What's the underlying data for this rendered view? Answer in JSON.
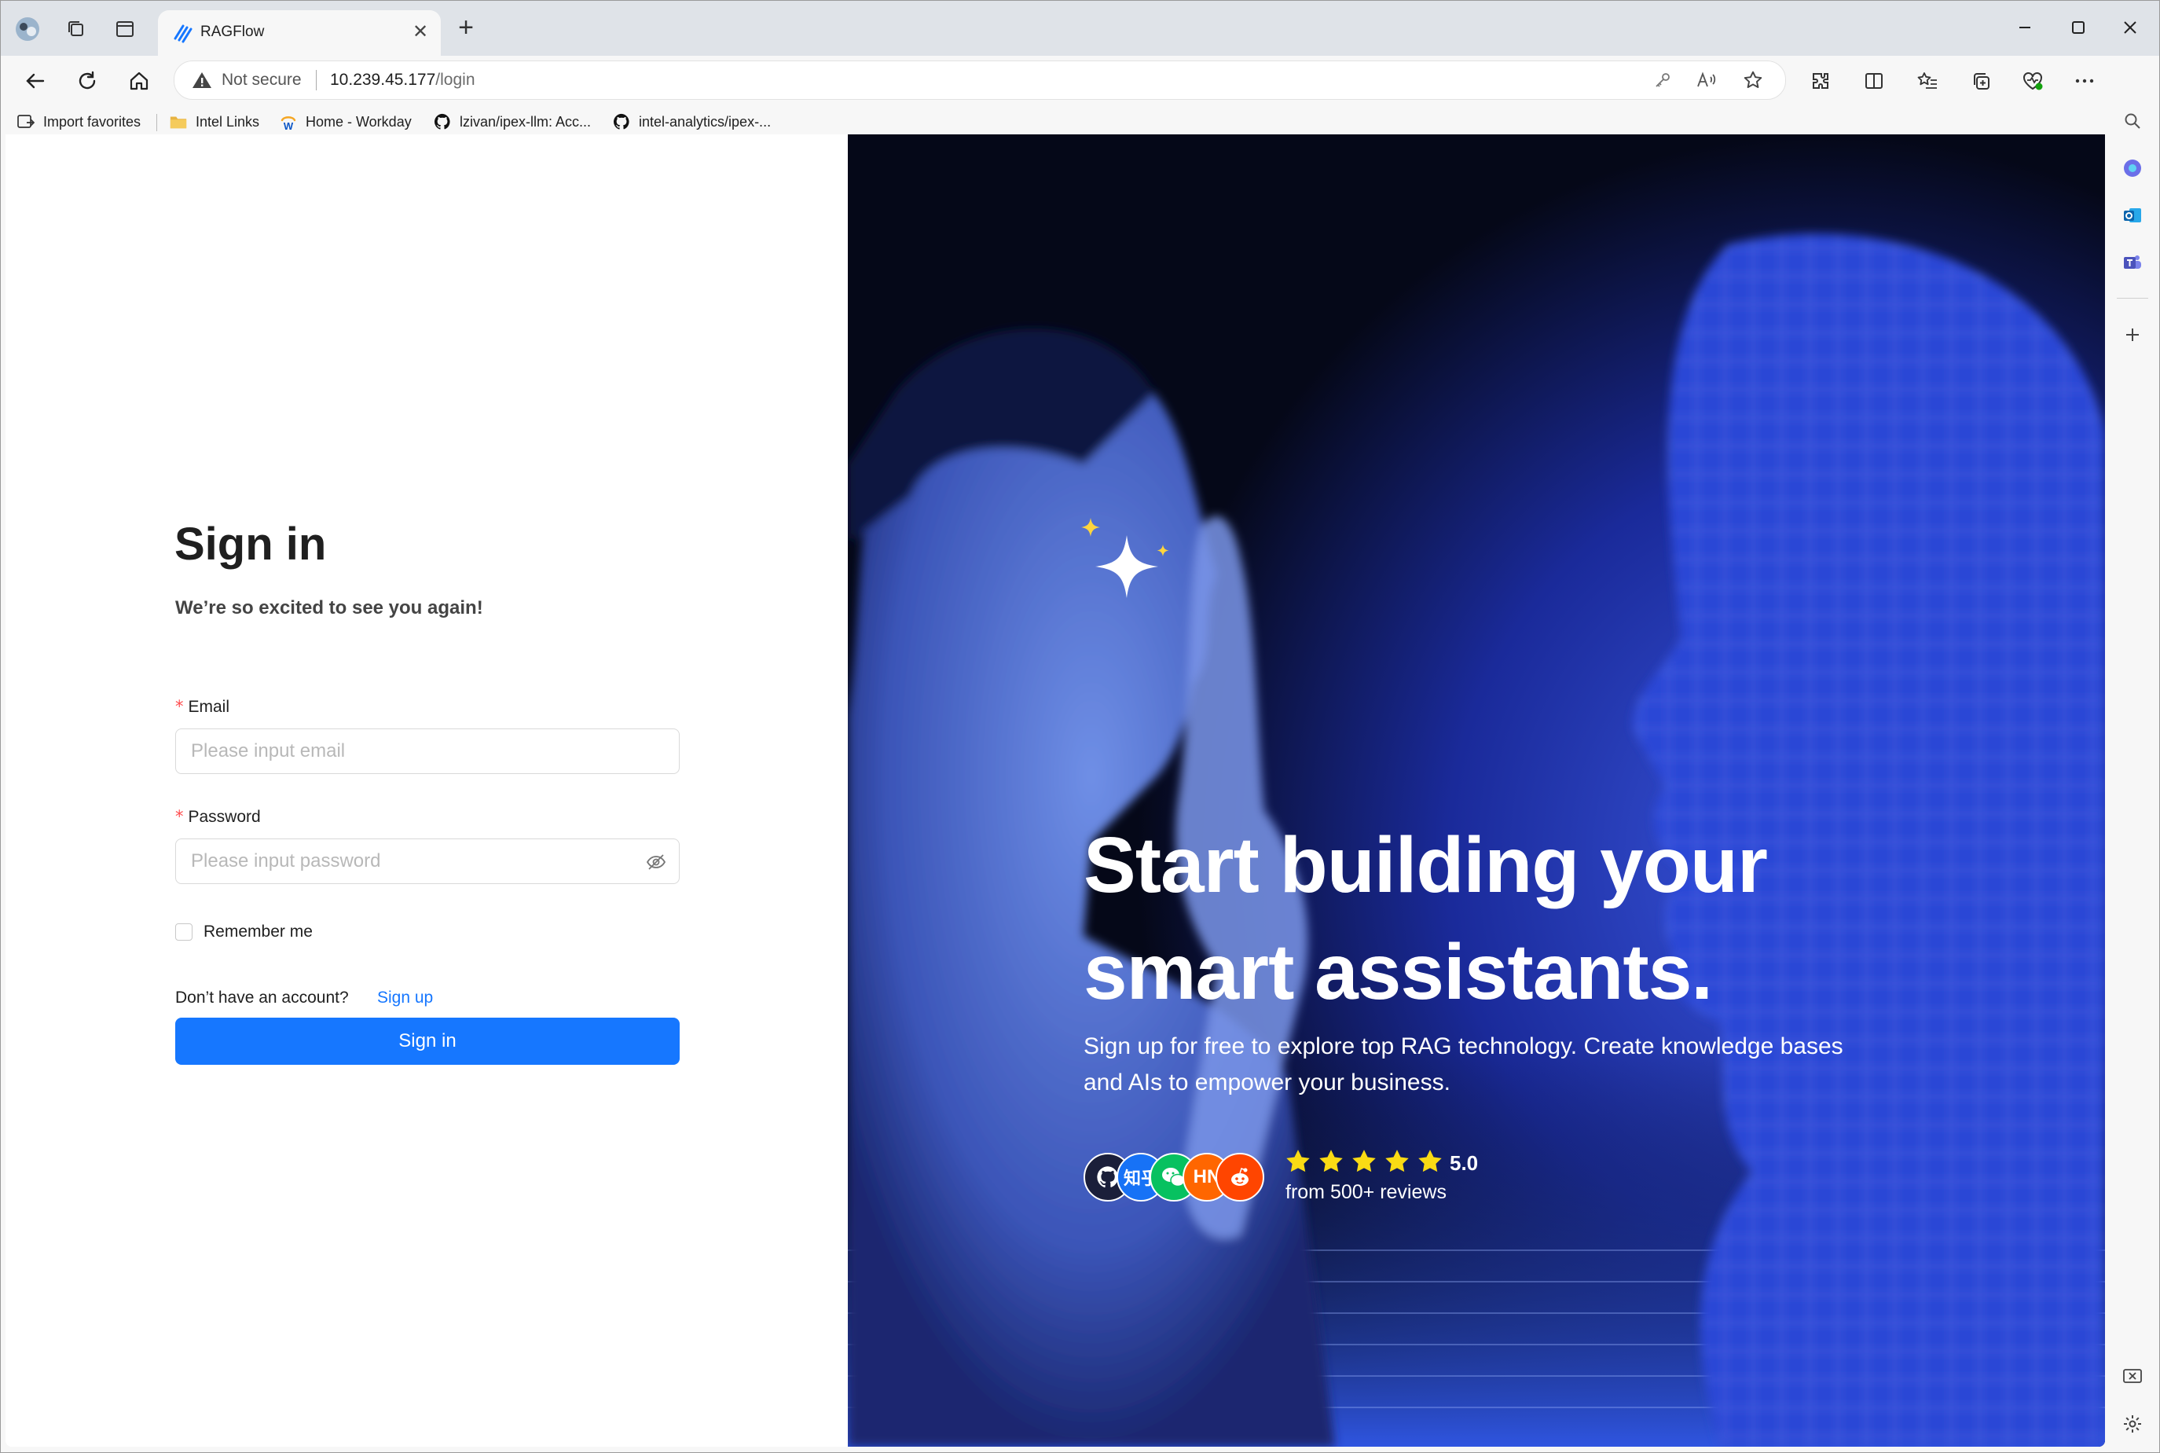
{
  "browser": {
    "tab": {
      "title": "RAGFlow"
    },
    "address": {
      "security_label": "Not secure",
      "host": "10.239.45.177",
      "path": "/login"
    },
    "favorites": [
      {
        "label": "Import favorites"
      },
      {
        "label": "Intel Links"
      },
      {
        "label": "Home - Workday"
      },
      {
        "label": "lzivan/ipex-llm: Acc..."
      },
      {
        "label": "intel-analytics/ipex-..."
      }
    ]
  },
  "login": {
    "title": "Sign in",
    "subtitle": "We’re so excited to see you again!",
    "email": {
      "label": "Email",
      "placeholder": "Please input email",
      "value": ""
    },
    "password": {
      "label": "Password",
      "placeholder": "Please input password",
      "value": ""
    },
    "remember_label": "Remember me",
    "remember_checked": false,
    "no_account_text": "Don’t have an account?",
    "signup_link": "Sign up",
    "submit_label": "Sign in",
    "required_mark": "*"
  },
  "hero": {
    "title_line1": "Start building your",
    "title_line2": "smart assistants.",
    "subtitle": "Sign up for free to explore top RAG technology. Create knowledge bases and AIs to empower your business.",
    "avatars": [
      {
        "icon": "github-icon",
        "color": "#1b1f3a"
      },
      {
        "icon": "zhihu-icon",
        "text": "知乎",
        "color": "#1772f6"
      },
      {
        "icon": "wechat-icon",
        "color": "#07c160"
      },
      {
        "icon": "hacker-news-icon",
        "text": "HN",
        "color": "#ff6600"
      },
      {
        "icon": "reddit-icon",
        "color": "#ff4500"
      }
    ],
    "stars": 5,
    "rating": "5.0",
    "reviews": "from 500+ reviews"
  },
  "colors": {
    "primary": "#1677ff",
    "star": "#fadb14",
    "required": "#ff4d4f"
  }
}
